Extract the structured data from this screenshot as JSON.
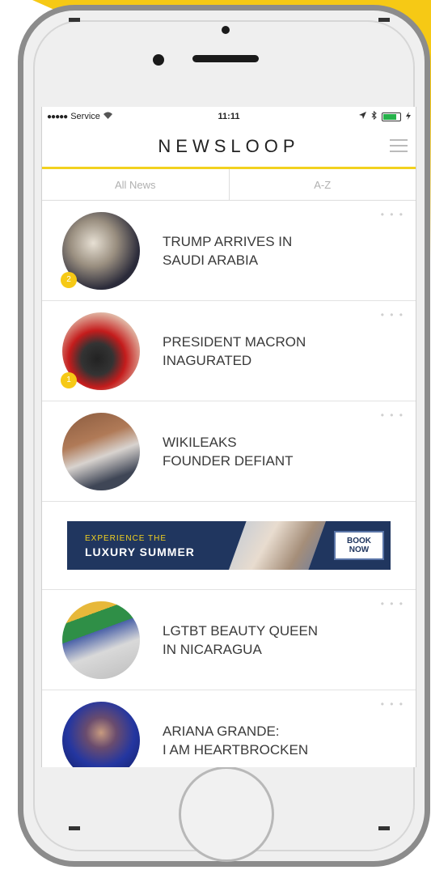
{
  "statusbar": {
    "carrier": "Service",
    "signal_dots": "●●●●●",
    "time": "11:11"
  },
  "app": {
    "logo": "NEWSLOOP",
    "accent_color": "#f2d11f"
  },
  "tabs": [
    {
      "label": "All News"
    },
    {
      "label": "A-Z"
    }
  ],
  "news": [
    {
      "headline_line1": "TRUMP ARRIVES IN",
      "headline_line2": "SAUDI ARABIA",
      "badge": "2"
    },
    {
      "headline_line1": "PRESIDENT MACRON",
      "headline_line2": "INAGURATED",
      "badge": "1"
    },
    {
      "headline_line1": "WIKILEAKS",
      "headline_line2": "FOUNDER DEFIANT"
    },
    {
      "headline_line1": "LGTBT BEAUTY QUEEN",
      "headline_line2": "IN NICARAGUA"
    },
    {
      "headline_line1": "ARIANA GRANDE:",
      "headline_line2": "I AM HEARTBROCKEN"
    }
  ],
  "ad": {
    "line1": "EXPERIENCE THE",
    "line2": "LUXURY SUMMER",
    "button_line1": "BOOK",
    "button_line2": "NOW"
  },
  "more_label": "• • •"
}
